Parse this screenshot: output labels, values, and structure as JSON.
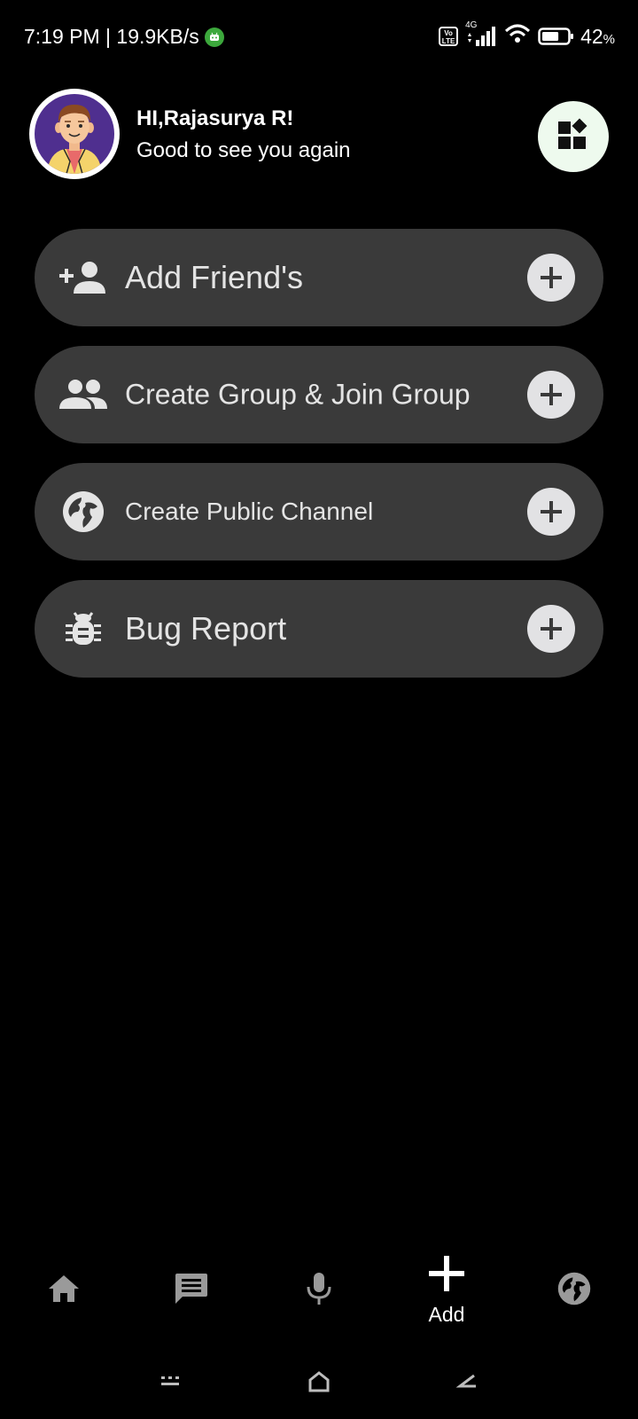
{
  "status_bar": {
    "time_speed": "7:19 PM | 19.9KB/s",
    "network_type": "4G",
    "volte_top": "Vo",
    "volte_bottom": "LTE",
    "battery_percent": "42",
    "battery_suffix": "%",
    "battery_level": 0.42
  },
  "header": {
    "greeting": "HI,Rajasurya R!",
    "subtitle": "Good to see you again",
    "avatar_icon": "avatar-illustration",
    "action_icon": "widgets-icon"
  },
  "menu": {
    "items": [
      {
        "label": "Add Friend's",
        "icon": "person-add-icon"
      },
      {
        "label": "Create Group & Join Group",
        "icon": "group-icon"
      },
      {
        "label": "Create Public Channel",
        "icon": "globe-icon"
      },
      {
        "label": "Bug Report",
        "icon": "bug-icon"
      }
    ]
  },
  "bottom_nav": {
    "items": [
      {
        "icon": "home-icon"
      },
      {
        "icon": "chat-icon"
      },
      {
        "icon": "mic-icon"
      },
      {
        "icon": "add-icon",
        "label": "Add",
        "active": true
      },
      {
        "icon": "globe-icon"
      }
    ]
  },
  "colors": {
    "background": "#000000",
    "card": "#3a3a3a",
    "card_text": "#e4e4e4",
    "plus_circle": "#e2e2e4",
    "widget_button": "#eefaee",
    "nav_icon": "#9a9a9a",
    "avatar_bg": "#4f2f8f",
    "speed_dot": "#3ca83c"
  }
}
